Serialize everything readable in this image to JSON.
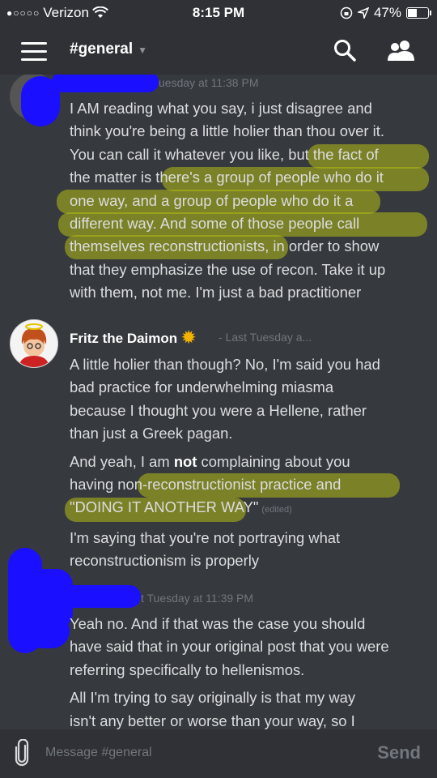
{
  "status_bar": {
    "carrier": "Verizon",
    "time": "8:15 PM",
    "battery_percent": "47%",
    "battery_level": 0.47
  },
  "header": {
    "channel_name": "#general"
  },
  "messages": [
    {
      "timestamp": "uesday at 11:38 PM",
      "lines": [
        "I AM reading what you say, i just disagree and",
        "think you're being a little holier than thou over it.",
        "You can call it whatever you like, but the fact of",
        "the matter is there's a group of people who do it",
        "one way, and a group of people who do it a",
        "different way. And some of those people call",
        "themselves reconstructionists, in order to show",
        "that they emphasize the use of recon. Take it up",
        "with them, not me. I'm just a bad practitioner"
      ]
    },
    {
      "author": "Fritz the Daimon",
      "timestamp": "Last Tuesday a...",
      "para1": [
        "A little holier than though? No, I'm said you had",
        "bad practice for underwhelming miasma",
        "because I thought you were a Hellene, rather",
        "than just a Greek pagan."
      ],
      "para2_line1": "And yeah, I am ",
      "para2_bold": "not",
      "para2_line1_end": " complaining about you",
      "para2_line2": "having non-reconstructionist practice and",
      "para2_line3": "\"DOING IT ANOTHER WAY\"",
      "edited": "(edited)",
      "para3": [
        "I'm saying that you're not portraying what",
        "reconstructionism is properly"
      ]
    },
    {
      "timestamp": "t Tuesday at 11:39 PM",
      "para1": [
        "Yeah no. And if that was the case you should",
        "have said that in your original post that you were",
        "referring specifically to hellenismos."
      ],
      "para2": [
        "All I'm trying to say originally is that my way",
        "isn't any better or worse than your way, so I"
      ]
    }
  ],
  "composer": {
    "placeholder": "Message #general",
    "send_label": "Send"
  },
  "colors": {
    "background": "#36393e",
    "header": "#2f3136",
    "highlight": "#b4be14",
    "redaction": "#1a10ff"
  }
}
